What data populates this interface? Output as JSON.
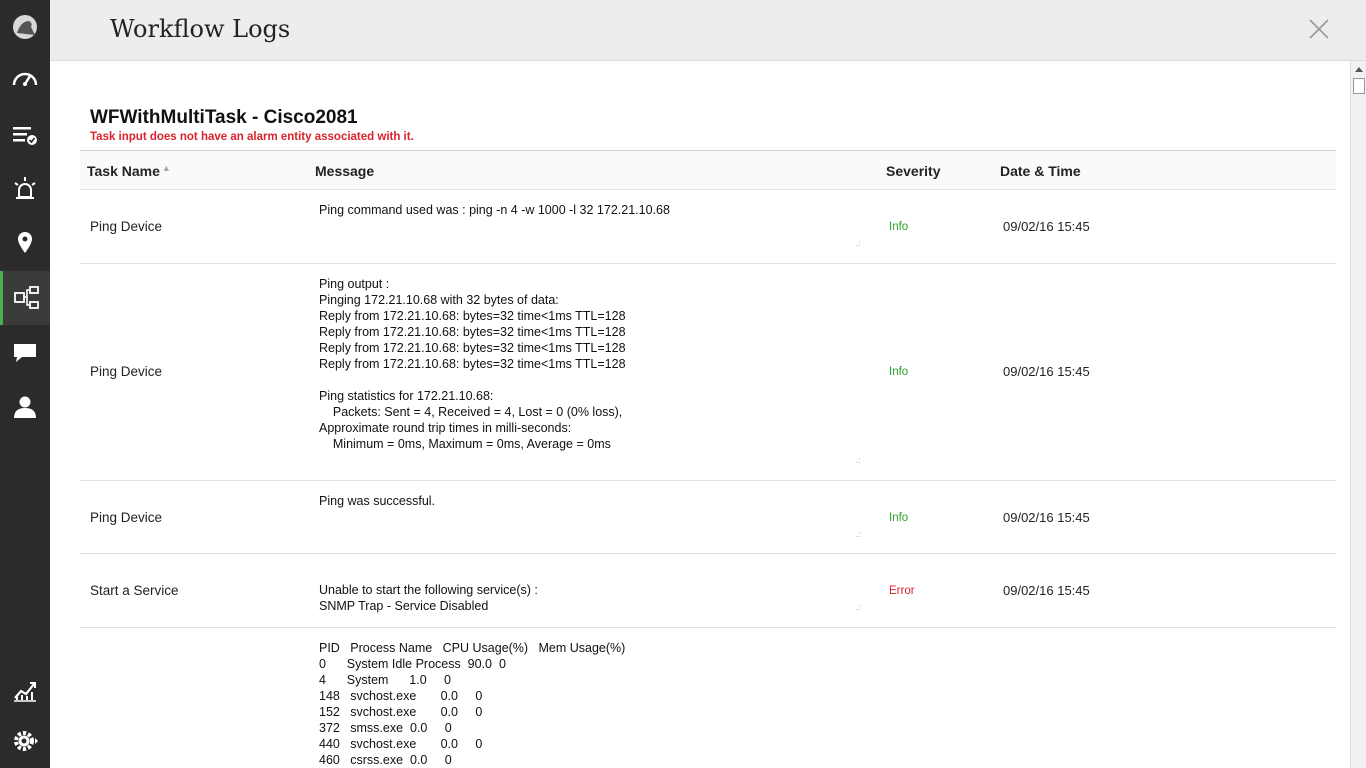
{
  "header": {
    "title": "Workflow Logs"
  },
  "workflow": {
    "title": "WFWithMultiTask - Cisco2081",
    "error": "Task input does not have an alarm entity associated with it."
  },
  "table": {
    "columns": {
      "task": "Task Name",
      "message": "Message",
      "severity": "Severity",
      "datetime": "Date & Time"
    },
    "rows": [
      {
        "task": "Ping Device",
        "message": "Ping command used was : ping -n 4 -w 1000 -l 32 172.21.10.68",
        "severity": "Info",
        "datetime": "09/02/16 15:45"
      },
      {
        "task": "Ping Device",
        "message": "Ping output :\nPinging 172.21.10.68 with 32 bytes of data:\nReply from 172.21.10.68: bytes=32 time<1ms TTL=128\nReply from 172.21.10.68: bytes=32 time<1ms TTL=128\nReply from 172.21.10.68: bytes=32 time<1ms TTL=128\nReply from 172.21.10.68: bytes=32 time<1ms TTL=128\n\nPing statistics for 172.21.10.68:\n    Packets: Sent = 4, Received = 4, Lost = 0 (0% loss),\nApproximate round trip times in milli-seconds:\n    Minimum = 0ms, Maximum = 0ms, Average = 0ms",
        "severity": "Info",
        "datetime": "09/02/16 15:45"
      },
      {
        "task": "Ping Device",
        "message": "Ping was successful.",
        "severity": "Info",
        "datetime": "09/02/16 15:45"
      },
      {
        "task": "Start a Service",
        "message": "Unable to start the following service(s) :\nSNMP Trap - Service Disabled",
        "severity": "Error",
        "datetime": "09/02/16 15:45"
      },
      {
        "task": "",
        "message": "PID   Process Name   CPU Usage(%)   Mem Usage(%)\n0      System Idle Process  90.0  0\n4      System      1.0     0\n148   svchost.exe       0.0     0\n152   svchost.exe       0.0     0\n372   smss.exe  0.0     0\n440   svchost.exe       0.0     0\n460   csrss.exe  0.0     0",
        "severity": "",
        "datetime": ""
      }
    ]
  },
  "sidebar": {
    "icons": [
      "logo-icon",
      "dashboard-icon",
      "inventory-icon",
      "alarms-icon",
      "maps-icon",
      "workflow-icon",
      "chat-icon",
      "user-icon",
      "reports-icon",
      "settings-icon"
    ]
  },
  "colors": {
    "sidebar_bg": "#2b2b2b",
    "active_accent": "#4caf50",
    "info": "#2ca02c",
    "error": "#d9232d"
  }
}
